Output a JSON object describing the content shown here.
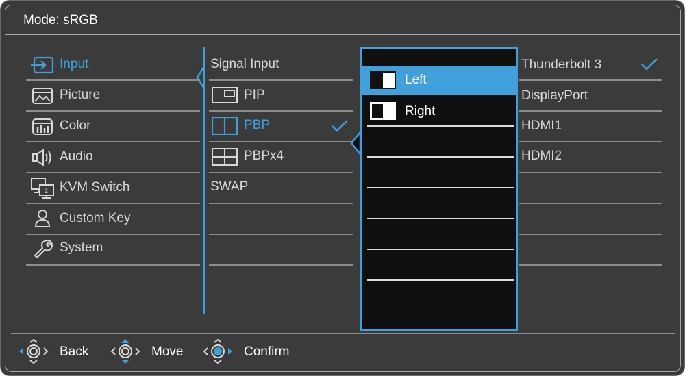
{
  "header": {
    "title": "Mode: sRGB"
  },
  "menu": [
    {
      "label": "Input",
      "icon": "input-icon",
      "active": true
    },
    {
      "label": "Picture",
      "icon": "picture-icon"
    },
    {
      "label": "Color",
      "icon": "color-icon"
    },
    {
      "label": "Audio",
      "icon": "audio-icon"
    },
    {
      "label": "KVM Switch",
      "icon": "kvm-switch-icon"
    },
    {
      "label": "Custom Key",
      "icon": "custom-key-icon"
    },
    {
      "label": "System",
      "icon": "system-icon"
    }
  ],
  "submenu": [
    {
      "label": "Signal Input"
    },
    {
      "label": "PIP",
      "icon": "pip-icon"
    },
    {
      "label": "PBP",
      "icon": "pbp-icon",
      "active": true,
      "checked": true
    },
    {
      "label": "PBPx4",
      "icon": "pbpx4-icon"
    },
    {
      "label": "SWAP"
    }
  ],
  "options": [
    {
      "label": "Left",
      "icon": "left-half-icon",
      "selected": true
    },
    {
      "label": "Right",
      "icon": "right-half-icon"
    }
  ],
  "sources": [
    {
      "label": "Thunderbolt 3",
      "checked": true
    },
    {
      "label": "DisplayPort"
    },
    {
      "label": "HDMI1"
    },
    {
      "label": "HDMI2"
    }
  ],
  "footer": {
    "back": "Back",
    "move": "Move",
    "confirm": "Confirm"
  },
  "colors": {
    "accent": "#3fa0dc",
    "background": "#3b3b3b",
    "panel": "#0f0f0f",
    "text": "#d8d8d8"
  }
}
